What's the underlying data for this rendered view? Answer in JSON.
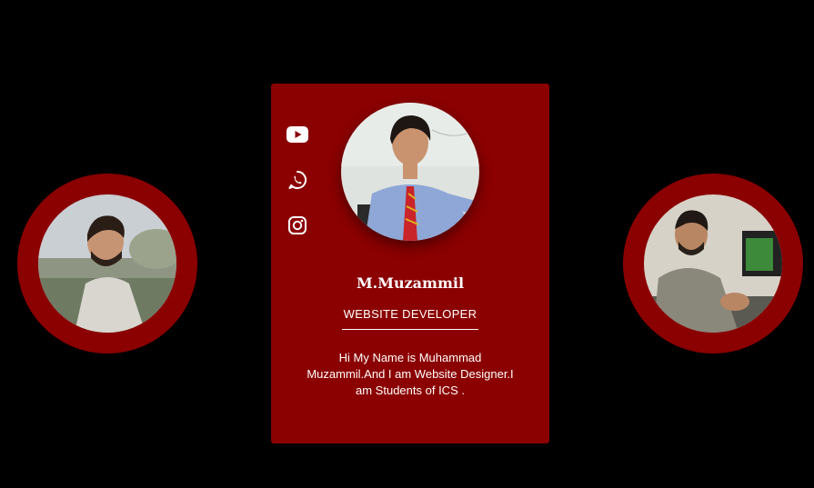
{
  "profile": {
    "name": "M.Muzammil",
    "role": "WEBSITE DEVELOPER",
    "bio": "Hi My Name is Muhammad Muzammil.And I am Website Designer.I am Students of ICS ."
  },
  "social": [
    {
      "icon": "youtube-icon"
    },
    {
      "icon": "whatsapp-icon"
    },
    {
      "icon": "instagram-icon"
    }
  ],
  "colors": {
    "background": "#000000",
    "accent": "#8b0000",
    "text": "#ffffff"
  }
}
